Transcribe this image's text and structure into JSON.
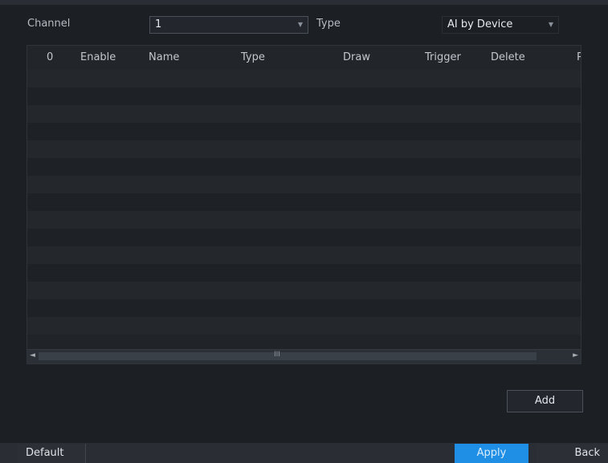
{
  "filters": {
    "channel_label": "Channel",
    "channel_value": "1",
    "type_label": "Type",
    "type_value": "AI by Device"
  },
  "table": {
    "headers": [
      "0",
      "Enable",
      "Name",
      "Type",
      "Draw",
      "Trigger",
      "Delete",
      "P"
    ],
    "rows": []
  },
  "scrollbar": {
    "left_arrow": "◄",
    "right_arrow": "►",
    "grip": "III"
  },
  "buttons": {
    "add": "Add",
    "default": "Default",
    "apply": "Apply",
    "back": "Back"
  },
  "colors": {
    "background": "#1c1f24",
    "accent": "#1f8fe6"
  }
}
